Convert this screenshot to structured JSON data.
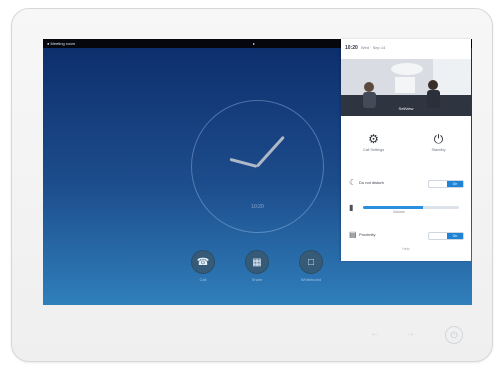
{
  "status_bar": {
    "left_text": "● Meeting room",
    "center_icon": "chat-bubble-icon"
  },
  "clock": {
    "caption": "10:20"
  },
  "actions": [
    {
      "label": "Call",
      "icon": "phone-icon"
    },
    {
      "label": "Share",
      "icon": "calendar-icon"
    },
    {
      "label": "Whiteboard",
      "icon": "whiteboard-icon"
    }
  ],
  "panel": {
    "time": "10:20",
    "header_rest": "Wed · Sep 14",
    "video_label": "Selfview",
    "items": [
      {
        "label": "Standby",
        "icon": "power-icon"
      },
      {
        "label": "Call Settings",
        "icon": "settings-icon"
      }
    ],
    "rows": [
      {
        "label": "Do not disturb",
        "icon": "moon-icon",
        "toggle": "On"
      },
      {
        "label": "Volume",
        "icon": "speaker-icon",
        "volume": 0.62,
        "caption": "Volume"
      },
      {
        "label": "Proximity",
        "icon": "signal-icon",
        "toggle": "On"
      }
    ],
    "more": "Help"
  },
  "colors": {
    "accent": "#1f84d6",
    "screen_top": "#0d2d6a",
    "screen_bottom": "#2f7fbb"
  }
}
